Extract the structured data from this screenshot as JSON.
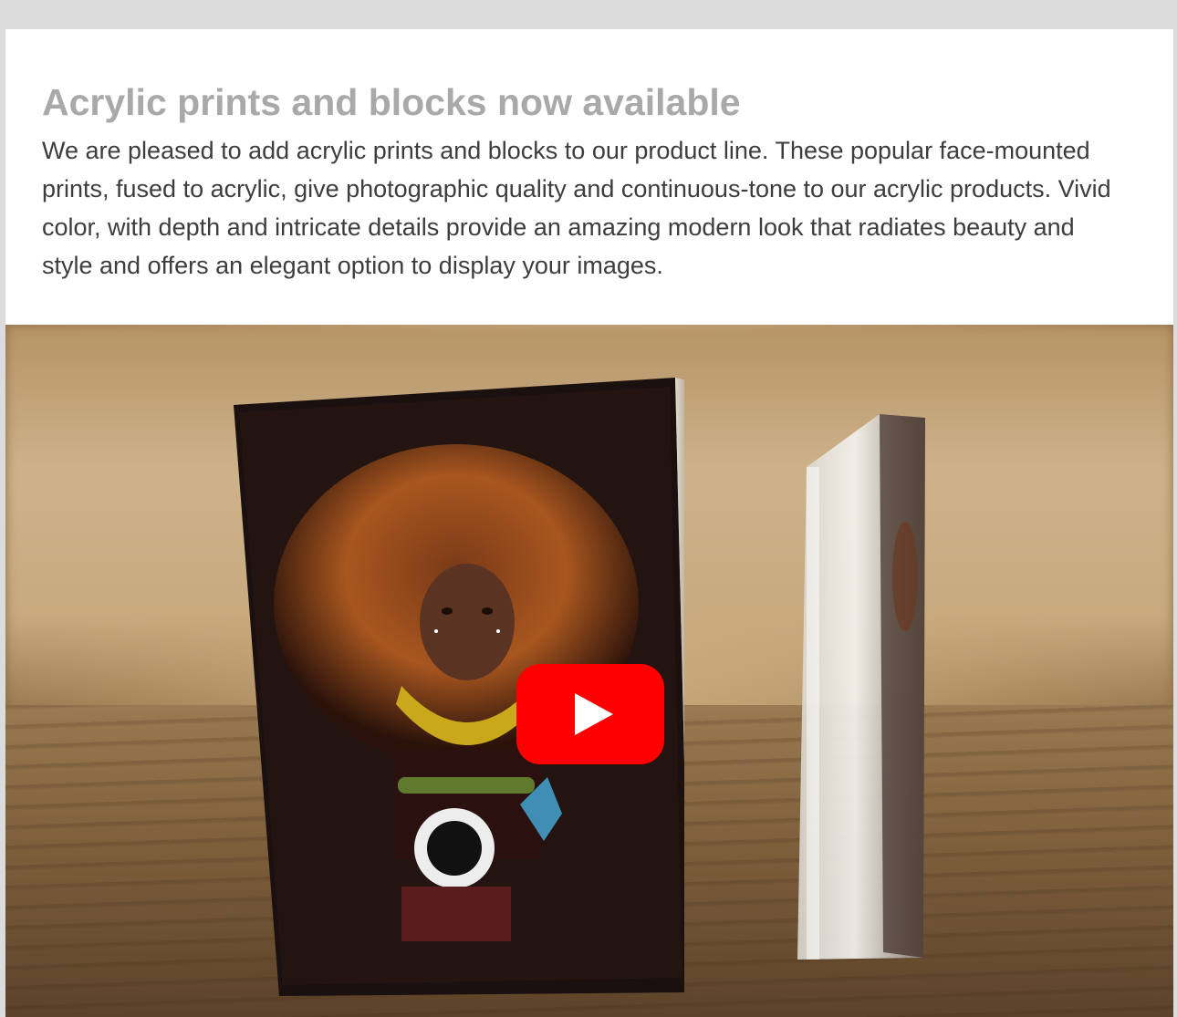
{
  "article": {
    "title": "Acrylic prints and blocks now available",
    "body": "We are pleased to add acrylic prints and blocks to our product line. These popular face-mounted prints, fused to acrylic, give photographic quality and continuous-tone to our acrylic products. Vivid color, with depth and intricate details provide an amazing modern look that radiates beauty and style and offers an elegant option to display your images."
  },
  "video": {
    "play_icon": "youtube-play-icon",
    "colors": {
      "play_button": "#ff0000",
      "play_triangle": "#ffffff"
    }
  },
  "colors": {
    "page_background": "#dcdcdc",
    "card_background": "#ffffff",
    "title": "#a9a9a9",
    "body_text": "#3d3d3d"
  }
}
